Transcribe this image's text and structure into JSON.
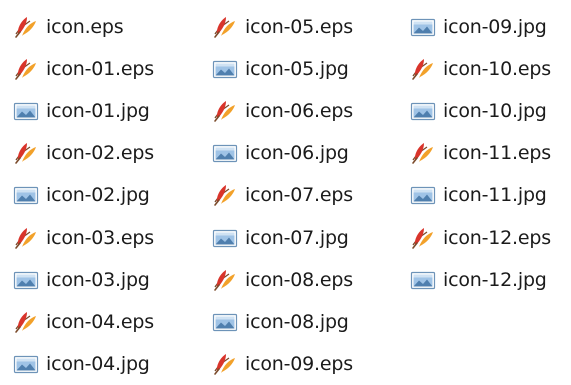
{
  "files": [
    {
      "name": "icon.eps",
      "icon": "vector-eps-icon"
    },
    {
      "name": "icon-01.eps",
      "icon": "vector-eps-icon"
    },
    {
      "name": "icon-01.jpg",
      "icon": "image-jpg-icon"
    },
    {
      "name": "icon-02.eps",
      "icon": "vector-eps-icon"
    },
    {
      "name": "icon-02.jpg",
      "icon": "image-jpg-icon"
    },
    {
      "name": "icon-03.eps",
      "icon": "vector-eps-icon"
    },
    {
      "name": "icon-03.jpg",
      "icon": "image-jpg-icon"
    },
    {
      "name": "icon-04.eps",
      "icon": "vector-eps-icon"
    },
    {
      "name": "icon-04.jpg",
      "icon": "image-jpg-icon"
    },
    {
      "name": "icon-05.eps",
      "icon": "vector-eps-icon"
    },
    {
      "name": "icon-05.jpg",
      "icon": "image-jpg-icon"
    },
    {
      "name": "icon-06.eps",
      "icon": "vector-eps-icon"
    },
    {
      "name": "icon-06.jpg",
      "icon": "image-jpg-icon"
    },
    {
      "name": "icon-07.eps",
      "icon": "vector-eps-icon"
    },
    {
      "name": "icon-07.jpg",
      "icon": "image-jpg-icon"
    },
    {
      "name": "icon-08.eps",
      "icon": "vector-eps-icon"
    },
    {
      "name": "icon-08.jpg",
      "icon": "image-jpg-icon"
    },
    {
      "name": "icon-09.eps",
      "icon": "vector-eps-icon"
    },
    {
      "name": "icon-09.jpg",
      "icon": "image-jpg-icon"
    },
    {
      "name": "icon-10.eps",
      "icon": "vector-eps-icon"
    },
    {
      "name": "icon-10.jpg",
      "icon": "image-jpg-icon"
    },
    {
      "name": "icon-11.eps",
      "icon": "vector-eps-icon"
    },
    {
      "name": "icon-11.jpg",
      "icon": "image-jpg-icon"
    },
    {
      "name": "icon-12.eps",
      "icon": "vector-eps-icon"
    },
    {
      "name": "icon-12.jpg",
      "icon": "image-jpg-icon"
    }
  ],
  "colors": {
    "background": "#ffffff",
    "text": "#1b1b1b",
    "eps_feather_red": "#d9342b",
    "eps_feather_orange": "#f2a12a",
    "jpg_frame": "#6d93b8",
    "jpg_sky": "#9fc3e6"
  }
}
